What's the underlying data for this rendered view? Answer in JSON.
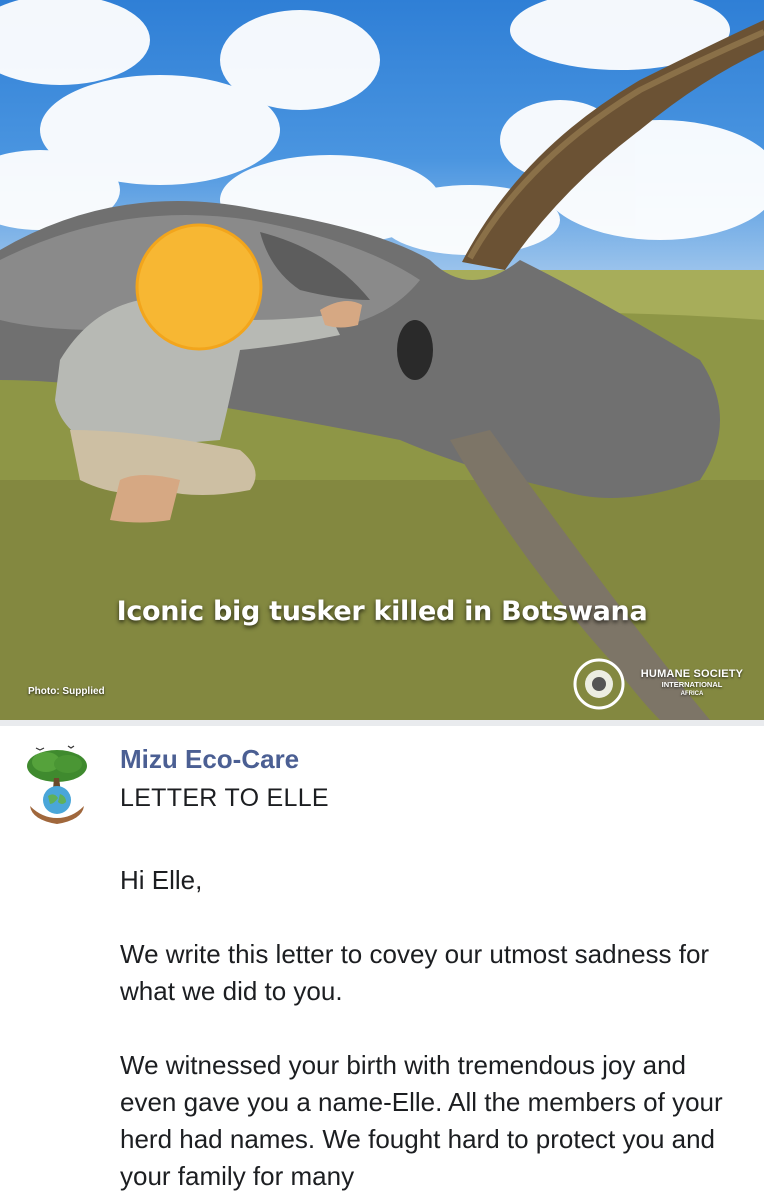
{
  "image": {
    "caption": "Iconic big tusker killed in Botswana",
    "photo_credit": "Photo: Supplied",
    "watermark": {
      "line1": "HUMANE SOCIETY",
      "line2": "INTERNATIONAL",
      "line3": "AFRICA"
    }
  },
  "post": {
    "author": "Mizu Eco-Care",
    "title": "LETTER TO ELLE",
    "paragraphs": [
      "Hi Elle,",
      "We write this letter to covey our utmost sadness for what we did to you.",
      "We witnessed your birth with tremendous joy and even gave you a name-Elle. All the members of your herd had names. We fought hard to protect you and your family for many"
    ]
  },
  "colors": {
    "author_link": "#4b5f93",
    "text": "#1c1e21",
    "divider": "#e9ebee"
  }
}
